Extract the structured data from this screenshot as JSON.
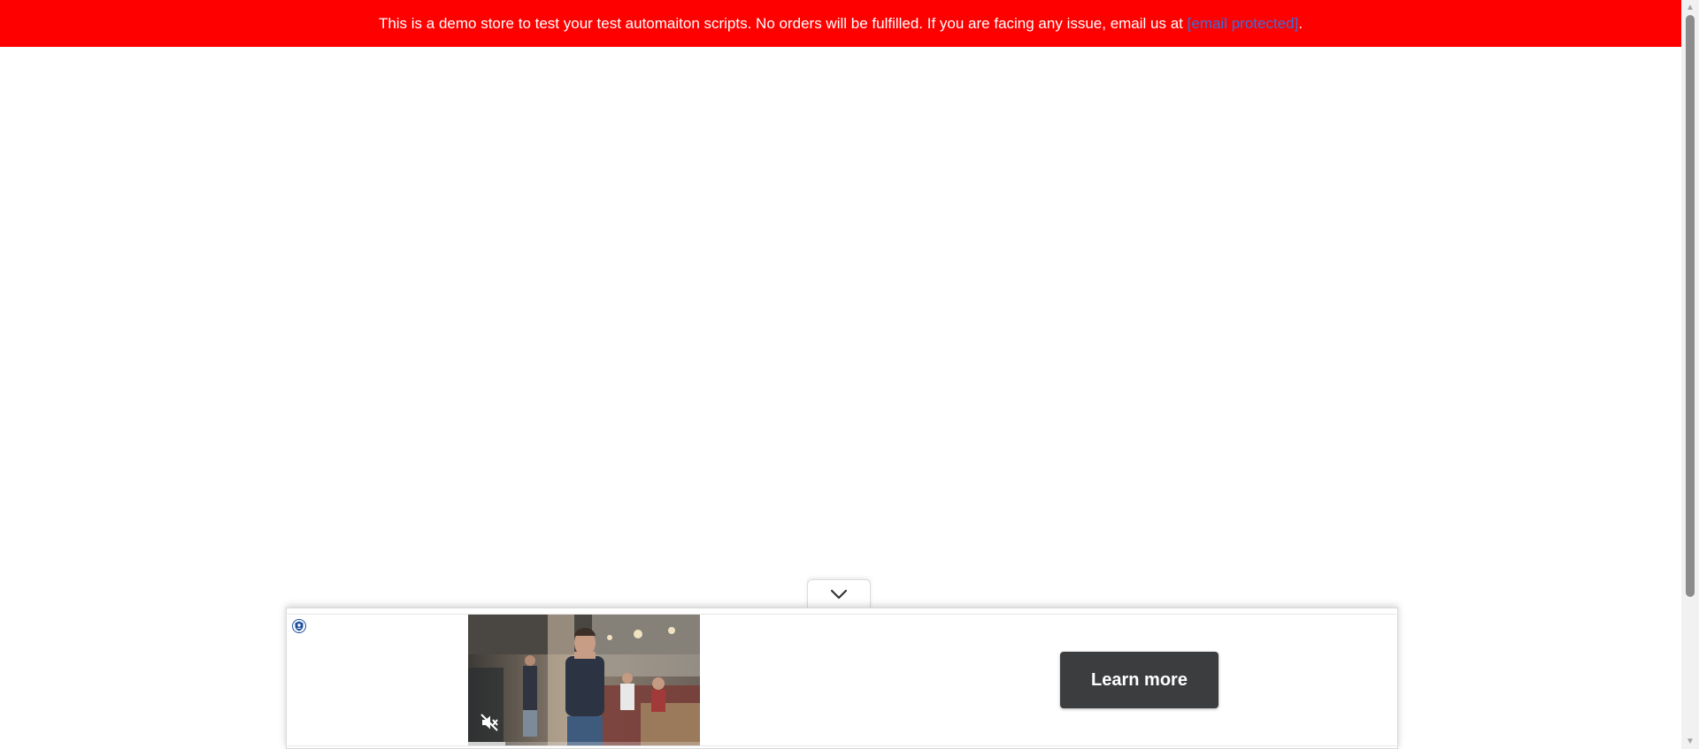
{
  "banner": {
    "text": "This is a demo store to test your test automaiton scripts. No orders will be fulfilled. If you are facing any issue, email us at ",
    "email_link": "[email protected]",
    "suffix": ".",
    "background": "#ff0000",
    "link_color": "#3b6fd6"
  },
  "ad": {
    "learn_more_label": "Learn more",
    "button_color": "#3c3d3f",
    "video_progress": 0.16,
    "icons": {
      "collapse": "chevron-down-icon",
      "adchoices": "adchoices-icon",
      "mute": "mute-icon"
    }
  }
}
